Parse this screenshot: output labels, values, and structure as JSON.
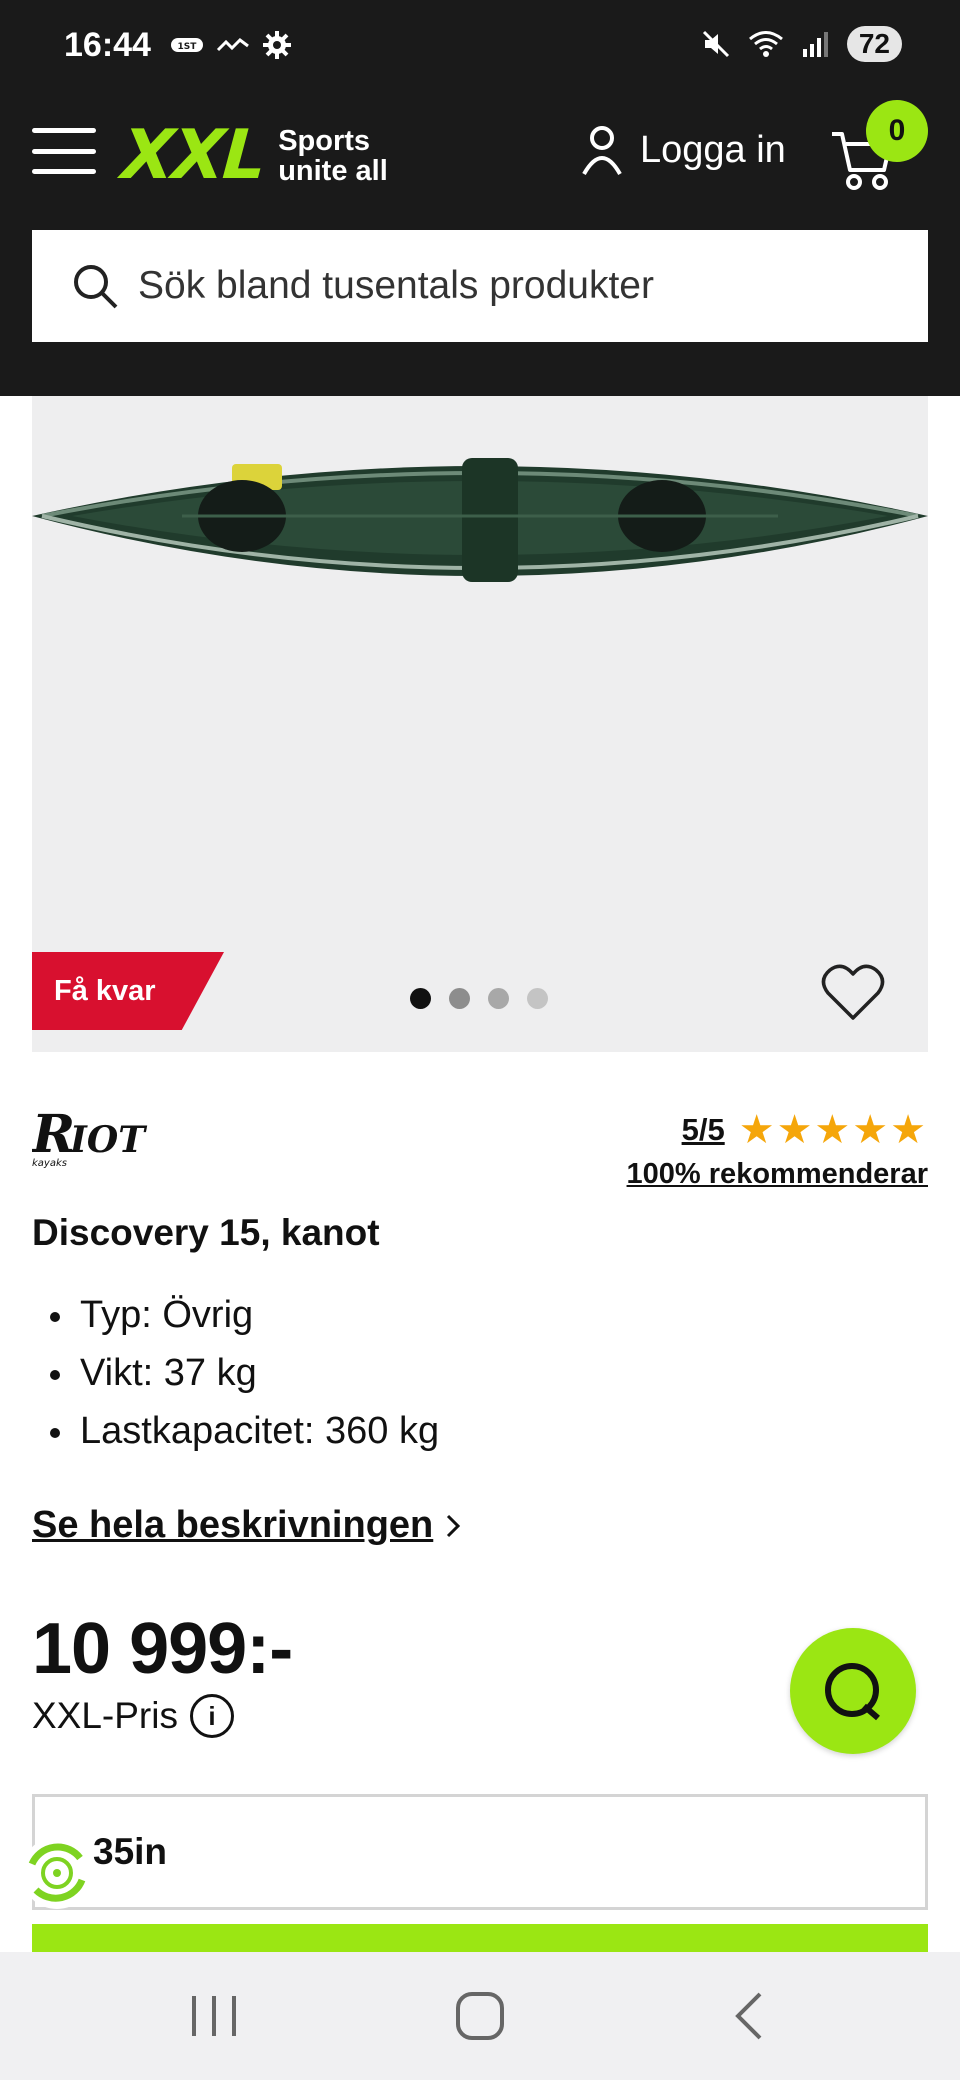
{
  "status_bar": {
    "time": "16:44",
    "battery": "72"
  },
  "header": {
    "logo_text": "XXL",
    "logo_tagline_1": "Sports",
    "logo_tagline_2": "unite all",
    "login_label": "Logga in",
    "cart_count": "0",
    "search_placeholder": "Sök bland tusentals produkter",
    "accent_color": "#9be613"
  },
  "gallery": {
    "badge": "Få kvar",
    "image_count": 4,
    "active_index": 0
  },
  "product": {
    "brand": "Riot kayaks",
    "rating_score": "5/5",
    "stars": "★★★★★",
    "recommend": "100% rekommenderar",
    "title": "Discovery 15, kanot",
    "specs": [
      "Typ: Övrig",
      "Vikt: 37 kg",
      "Lastkapacitet: 360 kg"
    ],
    "description_link": "Se hela beskrivningen",
    "price": "10 999:-",
    "price_label": "XXL-Pris",
    "variant": "35in"
  }
}
